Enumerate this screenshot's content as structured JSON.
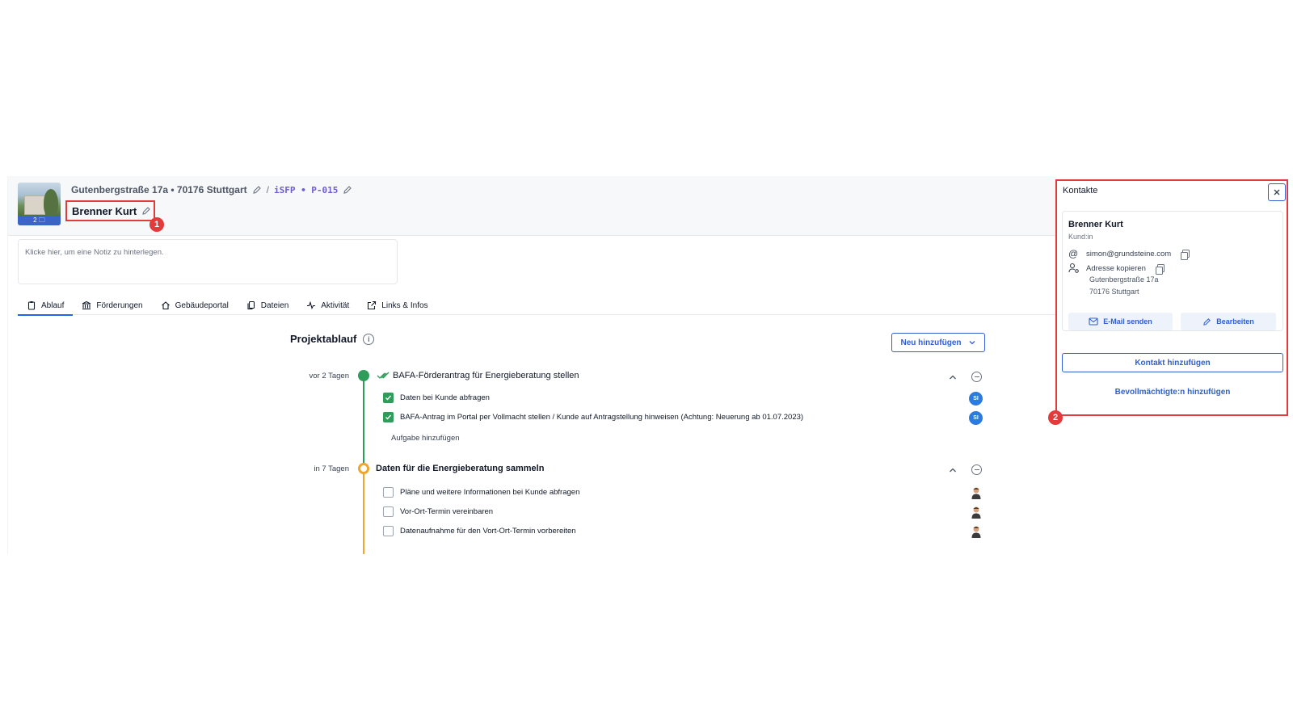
{
  "project": {
    "address": "Gutenbergstraße 17a • 70176 Stuttgart",
    "separator": "/",
    "project_id": "iSFP • P-015",
    "photo_count": "2",
    "client_name": "Brenner Kurt"
  },
  "annotations": {
    "badge_1": "1",
    "badge_2": "2"
  },
  "note": {
    "placeholder": "Klicke hier, um eine Notiz zu hinterlegen."
  },
  "tabs": [
    {
      "label": "Ablauf",
      "icon": "clipboard-icon",
      "active": true
    },
    {
      "label": "Förderungen",
      "icon": "bank-icon",
      "active": false
    },
    {
      "label": "Gebäudeportal",
      "icon": "house-icon",
      "active": false
    },
    {
      "label": "Dateien",
      "icon": "files-icon",
      "active": false
    },
    {
      "label": "Aktivität",
      "icon": "activity-icon",
      "active": false
    },
    {
      "label": "Links & Infos",
      "icon": "external-link-icon",
      "active": false
    }
  ],
  "timeline": {
    "title": "Projektablauf",
    "new_button": "Neu hinzufügen",
    "phases": [
      {
        "relative": "vor 2 Tagen",
        "status": "done",
        "title": "BAFA-Förderantrag für Energieberatung stellen",
        "tasks": [
          {
            "label": "Daten bei Kunde abfragen",
            "checked": true,
            "assignee": "SI"
          },
          {
            "label": "BAFA-Antrag im Portal per Vollmacht stellen / Kunde auf Antragstellung hinweisen (Achtung: Neuerung ab 01.07.2023)",
            "checked": true,
            "assignee": "SI"
          }
        ],
        "add_task": "Aufgabe hinzufügen"
      },
      {
        "relative": "in 7 Tagen",
        "status": "open",
        "title": "Daten für die Energieberatung sammeln",
        "tasks": [
          {
            "label": "Pläne und weitere Informationen bei Kunde abfragen",
            "checked": false
          },
          {
            "label": "Vor-Ort-Termin vereinbaren",
            "checked": false
          },
          {
            "label": "Datenaufnahme für den Vort-Ort-Termin vorbereiten",
            "checked": false
          }
        ]
      }
    ]
  },
  "contacts_panel": {
    "title": "Kontakte",
    "contact": {
      "name": "Brenner Kurt",
      "role": "Kund:in",
      "email": "simon@grundsteine.com",
      "copy_address_label": "Adresse kopieren",
      "street": "Gutenbergstraße 17a",
      "city": "70176 Stuttgart",
      "email_button": "E-Mail senden",
      "edit_button": "Bearbeiten"
    },
    "add_contact_button": "Kontakt hinzufügen",
    "add_proxy_link": "Bevollmächtigte:n hinzufügen"
  },
  "colors": {
    "accent": "#2f5fd0",
    "highlight": "#e23b3b",
    "done": "#2e9d5b",
    "pending": "#f0a52b"
  }
}
